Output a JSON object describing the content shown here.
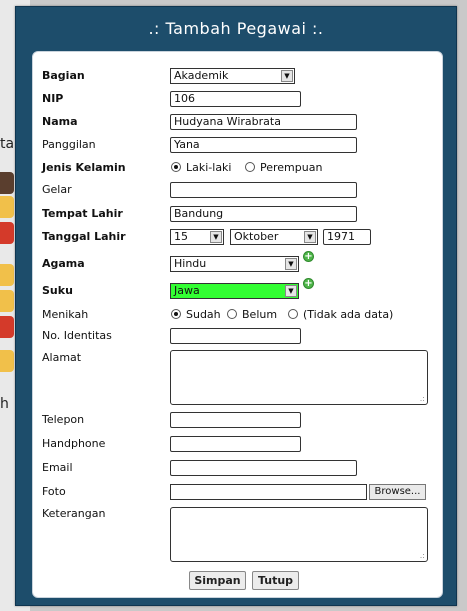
{
  "dialog": {
    "title": ".: Tambah Pegawai :."
  },
  "form": {
    "bagian": {
      "label": "Bagian",
      "value": "Akademik"
    },
    "nip": {
      "label": "NIP",
      "value": "106"
    },
    "nama": {
      "label": "Nama",
      "value": "Hudyana Wirabrata"
    },
    "panggilan": {
      "label": "Panggilan",
      "value": "Yana"
    },
    "jenis_kelamin": {
      "label": "Jenis Kelamin",
      "options": [
        "Laki-laki",
        "Perempuan"
      ],
      "selected": "Laki-laki"
    },
    "gelar": {
      "label": "Gelar",
      "value": ""
    },
    "tempat_lahir": {
      "label": "Tempat Lahir",
      "value": "Bandung"
    },
    "tanggal_lahir": {
      "label": "Tanggal Lahir",
      "day": "15",
      "month": "Oktober",
      "year": "1971"
    },
    "agama": {
      "label": "Agama",
      "value": "Hindu"
    },
    "suku": {
      "label": "Suku",
      "value": "Jawa",
      "highlight": "#33ff33"
    },
    "menikah": {
      "label": "Menikah",
      "options": [
        "Sudah",
        "Belum",
        "(Tidak ada data)"
      ],
      "selected": "Sudah"
    },
    "no_identitas": {
      "label": "No. Identitas",
      "value": ""
    },
    "alamat": {
      "label": "Alamat",
      "value": ""
    },
    "telepon": {
      "label": "Telepon",
      "value": ""
    },
    "handphone": {
      "label": "Handphone",
      "value": ""
    },
    "email": {
      "label": "Email",
      "value": ""
    },
    "foto": {
      "label": "Foto",
      "value": "",
      "browse_label": "Browse..."
    },
    "keterangan": {
      "label": "Keterangan",
      "value": ""
    }
  },
  "buttons": {
    "save": "Simpan",
    "close": "Tutup"
  },
  "background": {
    "fragments": [
      "ta",
      "a",
      "h"
    ]
  },
  "colors": {
    "dialog_bg": "#1d4d6b",
    "panel_bg": "#ffffff",
    "accent_green": "#4fb54a"
  }
}
